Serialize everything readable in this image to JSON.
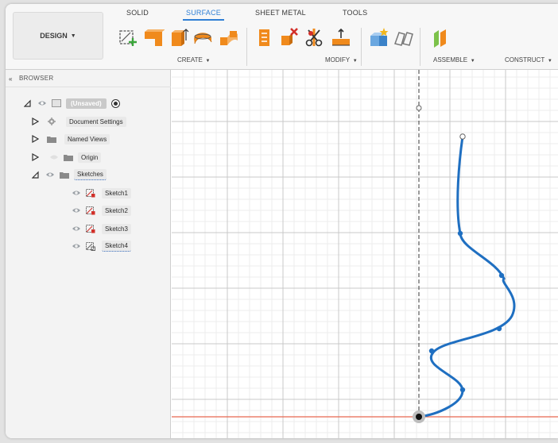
{
  "toolbar": {
    "workspace_button": "DESIGN",
    "tabs": [
      {
        "label": "SOLID",
        "active": false
      },
      {
        "label": "SURFACE",
        "active": true
      },
      {
        "label": "SHEET METAL",
        "active": false
      },
      {
        "label": "TOOLS",
        "active": false
      }
    ],
    "groups": [
      {
        "label": "CREATE"
      },
      {
        "label": "MODIFY"
      },
      {
        "label": "ASSEMBLE"
      },
      {
        "label": "CONSTRUCT"
      }
    ]
  },
  "browser": {
    "title": "BROWSER",
    "items": [
      {
        "label": "(Unsaved)"
      },
      {
        "label": "Document Settings"
      },
      {
        "label": "Named Views"
      },
      {
        "label": "Origin"
      },
      {
        "label": "Sketches"
      },
      {
        "label": "Sketch1"
      },
      {
        "label": "Sketch2"
      },
      {
        "label": "Sketch3"
      },
      {
        "label": "Sketch4"
      }
    ]
  },
  "colors": {
    "accent": "#2f7fd5",
    "spline": "#1f6fc1",
    "grid": "#cfcfcf",
    "x_axis": "#e8684f",
    "axis_dashed": "#3a3a3a"
  },
  "icons": [
    "create-sketch-icon",
    "extrude-icon",
    "revolve-icon",
    "sweep-icon",
    "loft-icon",
    "patch-icon",
    "thicken-icon",
    "delete-icon",
    "trim-icon",
    "stitch-icon",
    "new-component-icon",
    "joint-icon",
    "offset-plane-icon",
    "eye-icon",
    "folder-icon",
    "gear-icon",
    "sketch-icon",
    "radio-icon"
  ]
}
